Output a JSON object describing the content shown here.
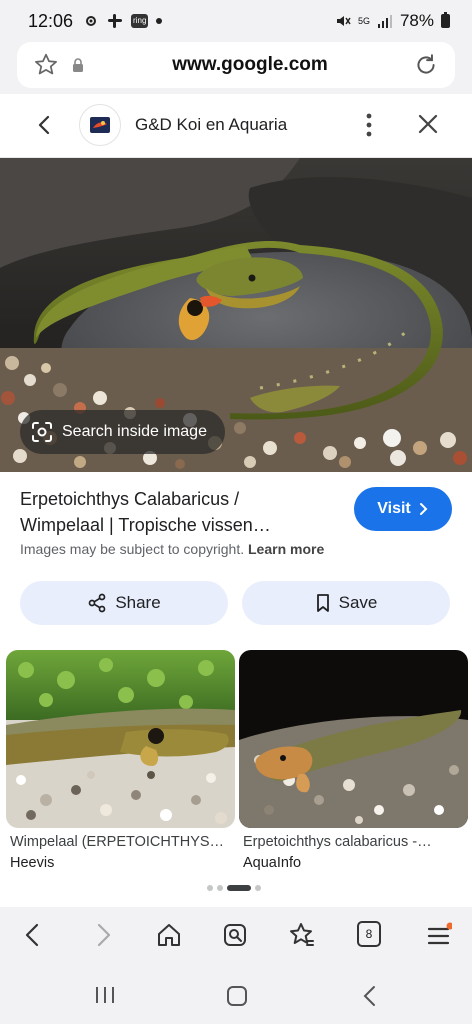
{
  "status_bar": {
    "time": "12:06",
    "ring_label": "ring",
    "network": "5G",
    "battery": "78%"
  },
  "browser": {
    "url": "www.google.com"
  },
  "header": {
    "site_name": "G&D Koi en Aquaria"
  },
  "hero": {
    "search_inside_label": "Search inside image"
  },
  "result": {
    "title_line1": "Erpetoichthys Calabaricus /",
    "title_line2": "Wimpelaal | Tropische vissen…",
    "visit_label": "Visit",
    "copyright_text": "Images may be subject to copyright.",
    "learn_more": "Learn more",
    "share_label": "Share",
    "save_label": "Save"
  },
  "related": [
    {
      "caption": "Wimpelaal (ERPETOICHTHYS…",
      "source": "Heevis"
    },
    {
      "caption": "Erpetoichthys calabaricus -…",
      "source": "AquaInfo"
    }
  ],
  "bottom_nav": {
    "tabs_count": "8"
  },
  "colors": {
    "accent": "#1a73e8",
    "chip_bg": "#e8eefb",
    "bar_bg": "#f2f2f4",
    "notification_dot": "#f06a2b"
  },
  "icons": [
    "settings-icon",
    "slack-icon",
    "mute-icon",
    "wifi-icon",
    "signal-icon",
    "battery-icon",
    "star-icon",
    "lock-icon",
    "reload-icon",
    "back-arrow-icon",
    "more-vert-icon",
    "close-icon",
    "lens-icon",
    "chevron-right-icon",
    "share-icon",
    "bookmark-icon",
    "home-icon",
    "search-icon",
    "bookmark-star-icon",
    "tabs-icon",
    "menu-icon"
  ]
}
